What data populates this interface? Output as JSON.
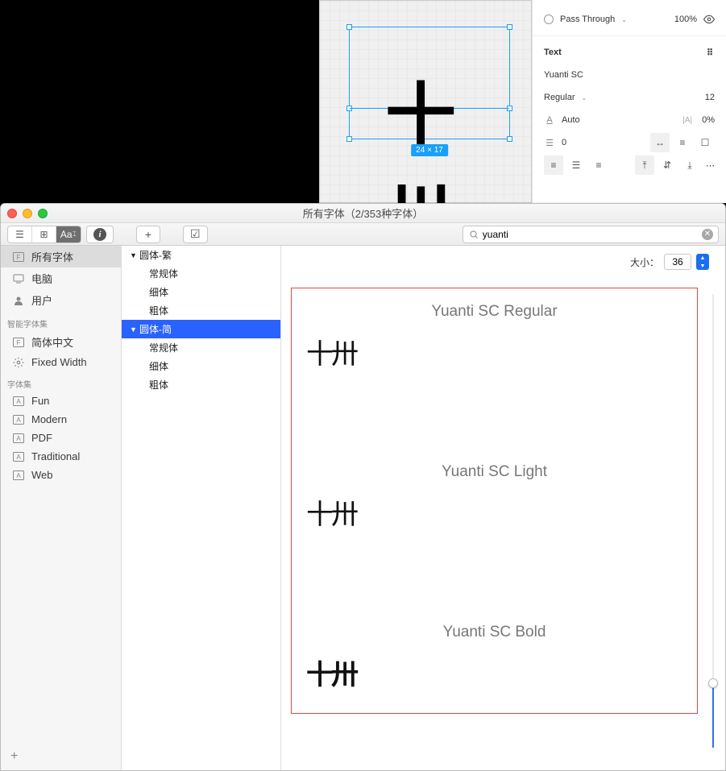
{
  "figma": {
    "blend_mode": "Pass Through",
    "opacity": "100%",
    "text_section": "Text",
    "font_family": "Yuanti SC",
    "font_weight": "Regular",
    "font_size": "12",
    "line_height": "Auto",
    "letter_spacing": "0%",
    "paragraph_spacing": "0",
    "canvas_sample": "十卅",
    "size_badge": "24 × 17"
  },
  "fontbook": {
    "window_title": "所有字体（2/353种字体）",
    "search_value": "yuanti",
    "sidebar": {
      "all_fonts": "所有字体",
      "computer": "电脑",
      "user": "用户",
      "smart_group": "智能字体集",
      "sc": "简体中文",
      "fixed_width": "Fixed Width",
      "collections_group": "字体集",
      "fun": "Fun",
      "modern": "Modern",
      "pdf": "PDF",
      "traditional": "Traditional",
      "web": "Web"
    },
    "font_list": {
      "family_tc": "圆体-繁",
      "family_sc": "圆体-简",
      "regular": "常规体",
      "light": "细体",
      "bold": "粗体"
    },
    "size_label": "大小：",
    "size_value": "36",
    "preview": {
      "title_regular": "Yuanti SC Regular",
      "title_light": "Yuanti SC Light",
      "title_bold": "Yuanti SC Bold",
      "sample": "十卅"
    }
  }
}
